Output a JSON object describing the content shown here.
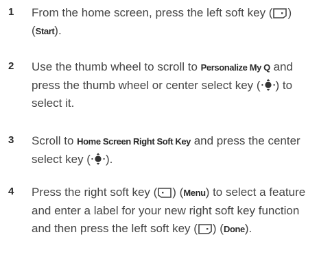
{
  "steps": [
    {
      "number": "1",
      "a": "From the home screen, press the left soft key (",
      "b": ") (",
      "kw1": "Start",
      "c": ")."
    },
    {
      "number": "2",
      "a": "Use the thumb wheel to scroll to ",
      "kw1": "Personalize My Q",
      "b": " and press the thumb wheel or center select key (",
      "c": ") to select it."
    },
    {
      "number": "3",
      "a": "Scroll to ",
      "kw1": "Home Screen Right Soft Key",
      "b": " and press the center select key (",
      "c": ")."
    },
    {
      "number": "4",
      "a": "Press the right soft key (",
      "b": ") (",
      "kw1": "Menu",
      "c": ") to select a feature and enter a label for your new right soft key function and then press the left soft key (",
      "d": ") (",
      "kw2": "Done",
      "e": ")."
    }
  ]
}
